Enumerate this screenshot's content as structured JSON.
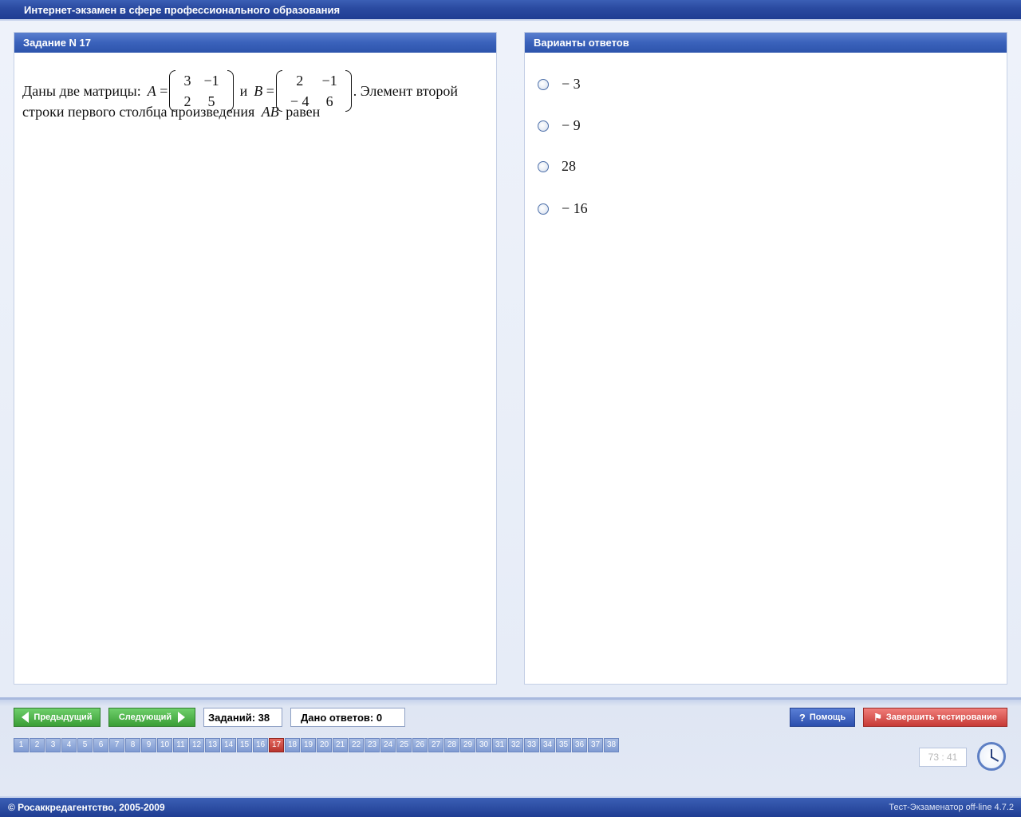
{
  "window": {
    "title": "Интернет-экзамен в сфере профессионального образования"
  },
  "question_panel": {
    "header": "Задание N 17",
    "text_intro": "Даны две матрицы:",
    "matrix_a_label": "A",
    "matrix_a": [
      [
        "3",
        "−1"
      ],
      [
        "2",
        "5"
      ]
    ],
    "conjunction": "и",
    "matrix_b_label": "B",
    "matrix_b": [
      [
        "2",
        "−1"
      ],
      [
        "− 4",
        "6"
      ]
    ],
    "text_after": ". Элемент второй",
    "text_line2_start": "строки первого столбца произведения",
    "product_label": "AB",
    "text_line2_end": "равен"
  },
  "answers_panel": {
    "header": "Варианты ответов",
    "options": [
      "− 3",
      "− 9",
      "28",
      "− 16"
    ]
  },
  "navigation": {
    "prev_label": "Предыдущий",
    "next_label": "Следующий",
    "tasks_count": "Заданий: 38",
    "answers_given": "Дано ответов: 0",
    "help_label": "Помощь",
    "finish_label": "Завершить тестирование",
    "pages": [
      "1",
      "2",
      "3",
      "4",
      "5",
      "6",
      "7",
      "8",
      "9",
      "10",
      "11",
      "12",
      "13",
      "14",
      "15",
      "16",
      "17",
      "18",
      "19",
      "20",
      "21",
      "22",
      "23",
      "24",
      "25",
      "26",
      "27",
      "28",
      "29",
      "30",
      "31",
      "32",
      "33",
      "34",
      "35",
      "36",
      "37",
      "38"
    ],
    "current_page": "17",
    "timer": "73 : 41"
  },
  "footer": {
    "copyright": "© Росаккредагентство, 2005-2009",
    "version": "Тест-Экзаменатор off-line 4.7.2"
  },
  "colors": {
    "title_bar": "#2a4aa0",
    "panel_header": "#3a62bb",
    "button_green": "#3a9e36",
    "button_help": "#2c4fae",
    "button_finish": "#c73a36",
    "page_active": "#b8342d"
  }
}
